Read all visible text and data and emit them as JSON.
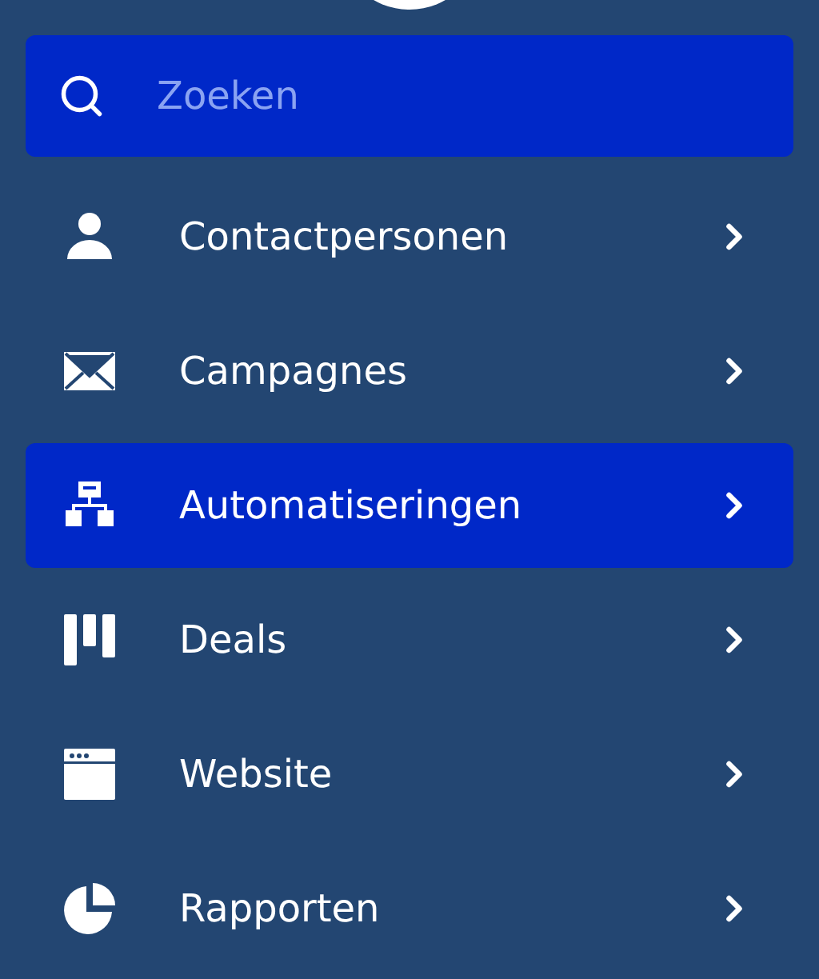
{
  "search": {
    "placeholder": "Zoeken"
  },
  "nav_items": [
    {
      "label": "Contactpersonen",
      "selected": false
    },
    {
      "label": "Campagnes",
      "selected": false
    },
    {
      "label": "Automatiseringen",
      "selected": true
    },
    {
      "label": "Deals",
      "selected": false
    },
    {
      "label": "Website",
      "selected": false
    },
    {
      "label": "Rapporten",
      "selected": false
    }
  ]
}
